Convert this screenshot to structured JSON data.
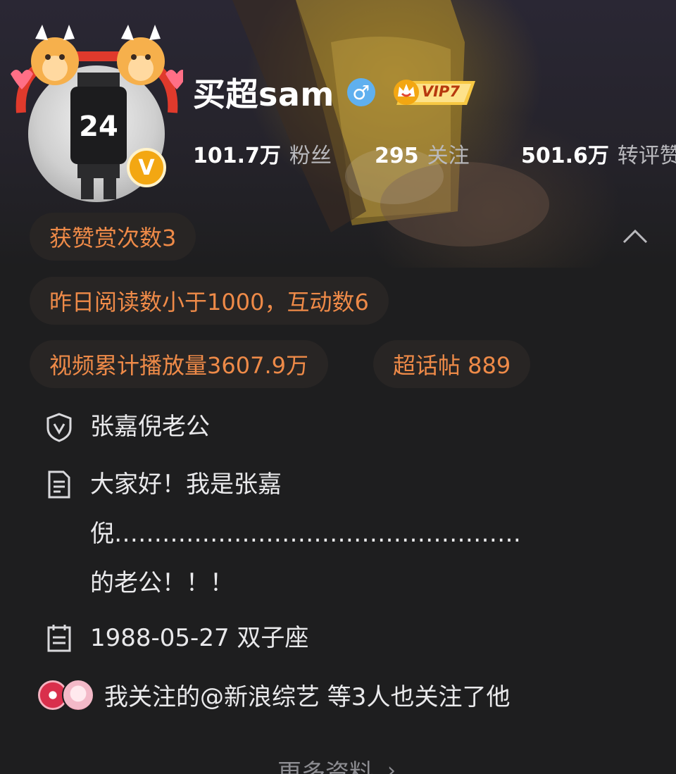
{
  "profile": {
    "username": "买超sam",
    "gender_icon": "♂",
    "vip_label": "VIP7",
    "verified_icon": "V"
  },
  "stats": {
    "followers": {
      "value": "101.7万",
      "label": "粉丝"
    },
    "following": {
      "value": "295",
      "label": "关注"
    },
    "reposts": {
      "value": "501.6万",
      "label": "转评赞"
    }
  },
  "highlights": {
    "rewards": "获赞赏次数3",
    "reads": "昨日阅读数小于1000，互动数6",
    "video_views": "视频累计播放量3607.9万",
    "super_topic": "超话帖 889"
  },
  "info": {
    "verification": "张嘉倪老公",
    "bio": "大家好！我是张嘉倪……………………………………………的老公！！！",
    "birthday": "1988-05-27 双子座"
  },
  "mutual": {
    "text": "我关注的@新浪综艺 等3人也关注了他"
  },
  "more": {
    "label": "更多资料",
    "arrow": "›"
  },
  "colors": {
    "background": "#1e1e1f",
    "accent_orange": "#ee8a48",
    "verified_gold": "#f3a712",
    "gender_blue": "#5fb0ef"
  }
}
